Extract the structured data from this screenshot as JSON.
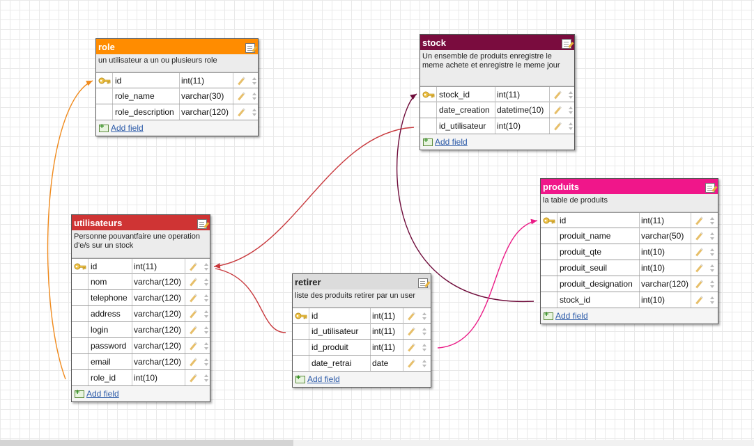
{
  "colors": {
    "role": "#ff8c00",
    "stock": "#7a0c3e",
    "utilisateurs": "#cf3434",
    "retirer": "#dcdcdc",
    "produits": "#f0168a",
    "link_role": "#f08a1c",
    "link_utilisateurs": "#c8383c",
    "link_stock": "#6e0b3a",
    "link_produits": "#ea1b86"
  },
  "icons": {
    "primary_key": "key-icon",
    "edit_table": "edit-table-icon",
    "edit_field": "pencil-icon",
    "reorder_field": "up-down-arrows-icon",
    "add_field": "add-field-icon"
  },
  "tables": {
    "role": {
      "title": "role",
      "description": "un utilisateur a un ou plusieurs role",
      "add_field_label": "Add field",
      "fields": [
        {
          "name": "id",
          "type": "int(11)",
          "primary": true
        },
        {
          "name": "role_name",
          "type": "varchar(30)",
          "primary": false
        },
        {
          "name": "role_description",
          "type": "varchar(120)",
          "primary": false
        }
      ]
    },
    "stock": {
      "title": "stock",
      "description": "Un ensemble de produits enregistre le meme achete et enregistre le meme jour",
      "add_field_label": "Add field",
      "fields": [
        {
          "name": "stock_id",
          "type": "int(11)",
          "primary": true
        },
        {
          "name": "date_creation",
          "type": "datetime(10)",
          "primary": false
        },
        {
          "name": "id_utilisateur",
          "type": "int(10)",
          "primary": false
        }
      ]
    },
    "produits": {
      "title": "produits",
      "description": "la table de produits",
      "add_field_label": "Add field",
      "fields": [
        {
          "name": "id",
          "type": "int(11)",
          "primary": true
        },
        {
          "name": "produit_name",
          "type": "varchar(50)",
          "primary": false
        },
        {
          "name": "produit_qte",
          "type": "int(10)",
          "primary": false
        },
        {
          "name": "produit_seuil",
          "type": "int(10)",
          "primary": false
        },
        {
          "name": "produit_designation",
          "type": "varchar(120)",
          "primary": false
        },
        {
          "name": "stock_id",
          "type": "int(10)",
          "primary": false
        }
      ]
    },
    "utilisateurs": {
      "title": "utilisateurs",
      "description": "Personne pouvantfaire une operation d'e/s sur un stock",
      "add_field_label": "Add field",
      "fields": [
        {
          "name": "id",
          "type": "int(11)",
          "primary": true
        },
        {
          "name": "nom",
          "type": "varchar(120)",
          "primary": false
        },
        {
          "name": "telephone",
          "type": "varchar(120)",
          "primary": false
        },
        {
          "name": "address",
          "type": "varchar(120)",
          "primary": false
        },
        {
          "name": "login",
          "type": "varchar(120)",
          "primary": false
        },
        {
          "name": "password",
          "type": "varchar(120)",
          "primary": false
        },
        {
          "name": "email",
          "type": "varchar(120)",
          "primary": false
        },
        {
          "name": "role_id",
          "type": "int(10)",
          "primary": false
        }
      ]
    },
    "retirer": {
      "title": "retirer",
      "description": "liste des produits retirer par un user",
      "add_field_label": "Add field",
      "fields": [
        {
          "name": "id",
          "type": "int(11)",
          "primary": true
        },
        {
          "name": "id_utilisateur",
          "type": "int(11)",
          "primary": false
        },
        {
          "name": "id_produit",
          "type": "int(11)",
          "primary": false
        },
        {
          "name": "date_retrai",
          "type": "date",
          "primary": false
        }
      ]
    }
  },
  "relations": [
    {
      "from_table": "utilisateurs",
      "from_field": "role_id",
      "to_table": "role",
      "to_field": "id"
    },
    {
      "from_table": "stock",
      "from_field": "id_utilisateur",
      "to_table": "utilisateurs",
      "to_field": "id"
    },
    {
      "from_table": "retirer",
      "from_field": "id_utilisateur",
      "to_table": "utilisateurs",
      "to_field": "id"
    },
    {
      "from_table": "produits",
      "from_field": "stock_id",
      "to_table": "stock",
      "to_field": "stock_id"
    },
    {
      "from_table": "retirer",
      "from_field": "id_produit",
      "to_table": "produits",
      "to_field": "id"
    }
  ]
}
